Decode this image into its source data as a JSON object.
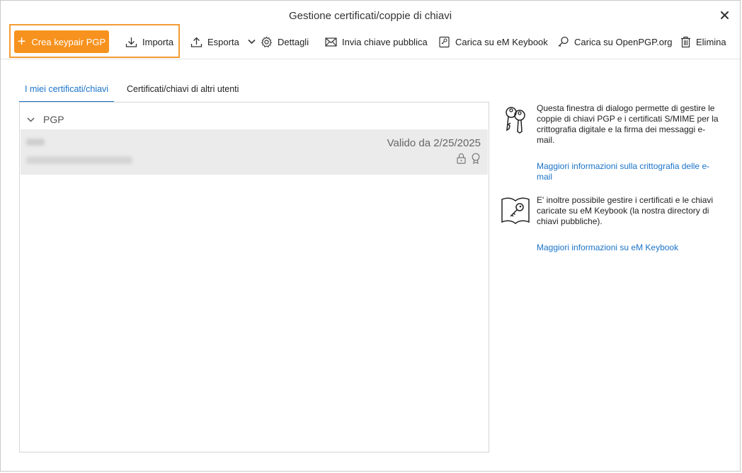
{
  "window": {
    "title": "Gestione certificati/coppie di chiavi"
  },
  "toolbar": {
    "create_label": "Crea keypair PGP",
    "import_label": "Importa",
    "export_label": "Esporta",
    "details_label": "Dettagli",
    "send_public_key_label": "Invia chiave pubblica",
    "upload_keybook_label": "Carica su eM Keybook",
    "upload_openpgp_label": "Carica su OpenPGP.org",
    "delete_label": "Elimina",
    "highlight_color": "#f39c33",
    "primary_color": "#f7921e"
  },
  "tabs": [
    {
      "label": "I miei certificati/chiavi",
      "active": true
    },
    {
      "label": "Certificati/chiavi di altri utenti",
      "active": false
    }
  ],
  "list": {
    "group_label": "PGP",
    "items": [
      {
        "validity": "Valido da 2/25/2025",
        "icons": [
          "lock-icon",
          "certificate-icon"
        ]
      }
    ]
  },
  "info": {
    "block1_text": "Questa finestra di dialogo permette di gestire le coppie di chiavi PGP e i certificati S/MIME per la crittografia digitale e la firma dei messaggi e-mail.",
    "block1_link": "Maggiori informazioni sulla crittografia delle e-mail",
    "block2_text": "E' inoltre possibile gestire i certificati e le chiavi caricate su eM Keybook (la nostra directory di chiavi pubbliche).",
    "block2_link": "Maggiori informazioni su eM Keybook",
    "link_color": "#1a73c8"
  }
}
